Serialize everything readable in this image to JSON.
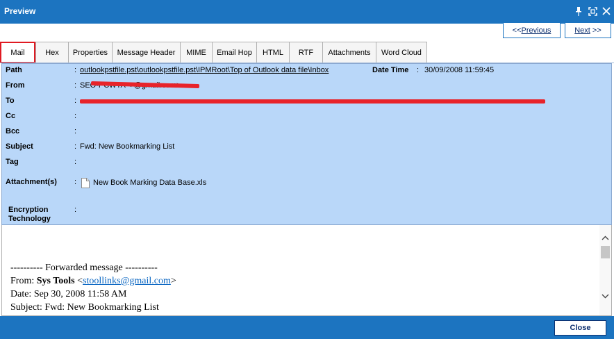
{
  "window": {
    "title": "Preview",
    "controls": [
      "pin-icon",
      "restore-icon",
      "close-icon"
    ],
    "accent_color": "#1c74c0"
  },
  "nav": {
    "previous_label": "Previous",
    "next_label": "Next"
  },
  "tabs": [
    {
      "label": "Mail",
      "active": true
    },
    {
      "label": "Hex"
    },
    {
      "label": "Properties"
    },
    {
      "label": "Message Header"
    },
    {
      "label": "MIME"
    },
    {
      "label": "Email Hop"
    },
    {
      "label": "HTML"
    },
    {
      "label": "RTF"
    },
    {
      "label": "Attachments"
    },
    {
      "label": "Word Cloud"
    }
  ],
  "info": {
    "background_color": "#b9d7f9",
    "path_label": "Path",
    "path_value": "outlookpstfile.pst\\outlookpstfile.pst\\IPMRoot\\Top of Outlook data file\\Inbox",
    "datetime_label": "Date Time",
    "datetime_value": "30/09/2008 11:59:45",
    "from_label": "From",
    "from_value": "SEO-PCWTA <             @gmail.com>",
    "to_label": "To",
    "cc_label": "Cc",
    "bcc_label": "Bcc",
    "subject_label": "Subject",
    "subject_value": "Fwd: New Bookmarking List",
    "tag_label": "Tag",
    "attachments_label": "Attachment(s)",
    "attachment_name": "New Book Marking Data Base.xls",
    "encryption_label_line1": "Encryption",
    "encryption_label_line2": "Technology",
    "colon": ":",
    "redaction_color": "#e8232a"
  },
  "body": {
    "forwarded_line": "---------- Forwarded message ----------",
    "from_prefix": "From: ",
    "from_name": "Sys Tools",
    "from_email": "stoollinks@gmail.com",
    "date_line": "Date: Sep 30, 2008 11:58 AM",
    "subject_line": "Subject: Fwd: New Bookmarking List"
  },
  "footer": {
    "close_label": "Close"
  }
}
